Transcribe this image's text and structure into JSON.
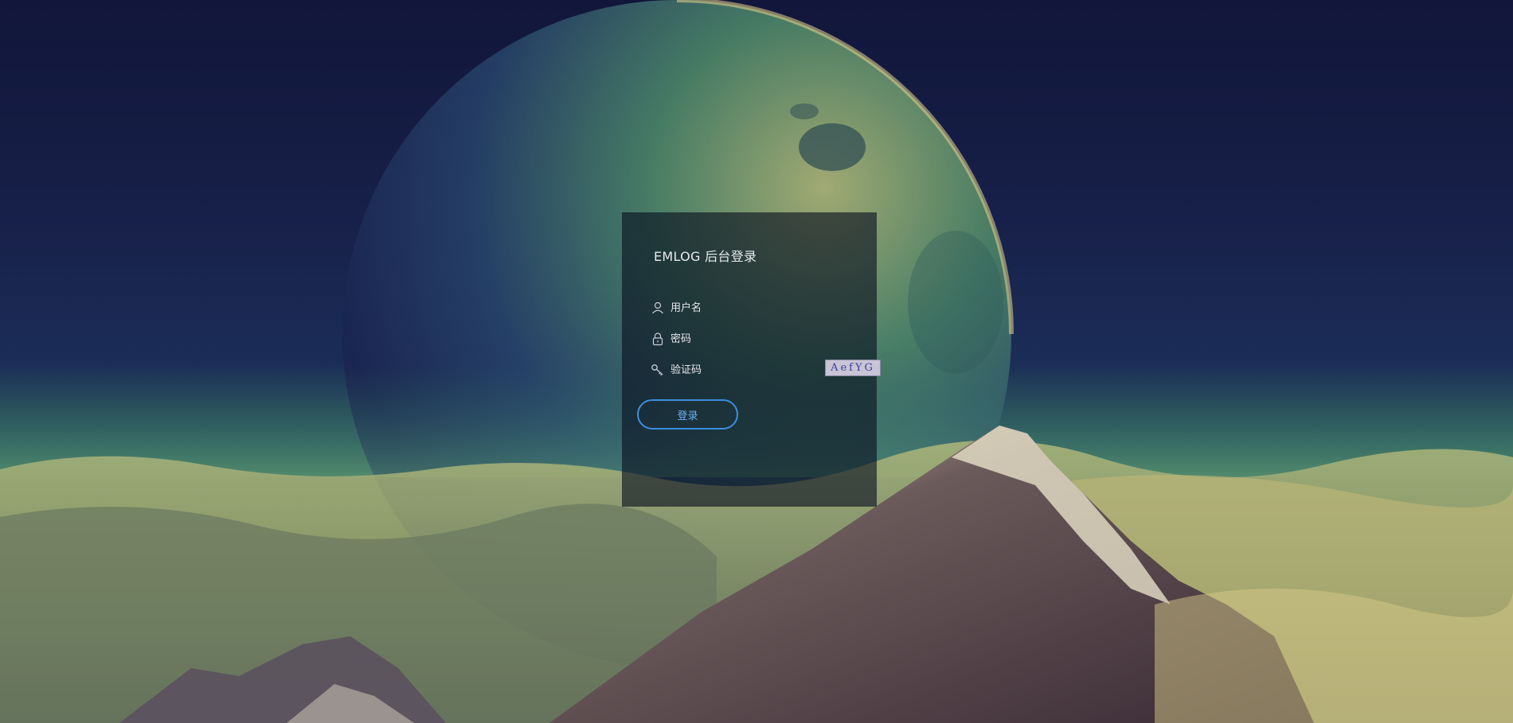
{
  "window": {
    "title": "EMLOG 后台登录"
  },
  "login": {
    "title": "EMLOG 后台登录",
    "username_placeholder": "用户名",
    "password_placeholder": "密码",
    "captcha_placeholder": "验证码",
    "captcha_text": "AefYG",
    "submit_label": "登录"
  },
  "icons": {
    "username": "user-icon",
    "password": "lock-icon",
    "captcha": "key-icon"
  },
  "colors": {
    "accent": "#3b8ee0",
    "panel_bg": "#080e1e",
    "text": "#e6e8ee"
  }
}
